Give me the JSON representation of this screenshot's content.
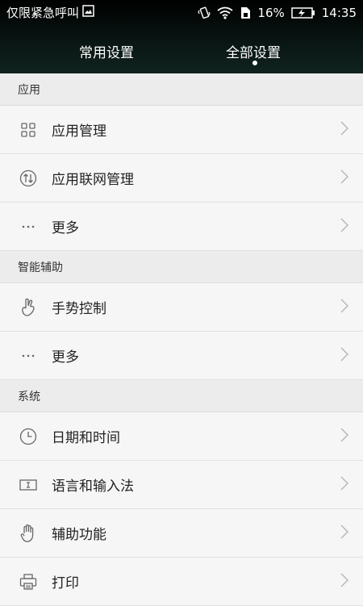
{
  "status_bar": {
    "carrier": "仅限紧急呼叫",
    "battery": "16%",
    "time": "14:35"
  },
  "tabs": [
    {
      "label": "常用设置",
      "selected": false
    },
    {
      "label": "全部设置",
      "selected": true
    }
  ],
  "sections": {
    "apps": {
      "title": "应用",
      "items": [
        {
          "label": "应用管理",
          "icon": "apps-grid-icon"
        },
        {
          "label": "应用联网管理",
          "icon": "network-arrows-icon"
        },
        {
          "label": "更多",
          "icon": "more-dots-icon"
        }
      ]
    },
    "assist": {
      "title": "智能辅助",
      "items": [
        {
          "label": "手势控制",
          "icon": "gesture-hand-icon"
        },
        {
          "label": "更多",
          "icon": "more-dots-icon"
        }
      ]
    },
    "system": {
      "title": "系统",
      "items": [
        {
          "label": "日期和时间",
          "icon": "clock-icon"
        },
        {
          "label": "语言和输入法",
          "icon": "keyboard-input-icon"
        },
        {
          "label": "辅助功能",
          "icon": "accessibility-hand-icon"
        },
        {
          "label": "打印",
          "icon": "printer-icon"
        }
      ]
    }
  },
  "colors": {
    "header_bg": "#000000",
    "list_bg": "#f6f6f6",
    "section_bg": "#ececec",
    "divider": "#e0e0e0",
    "chevron": "#b5b5b5"
  }
}
